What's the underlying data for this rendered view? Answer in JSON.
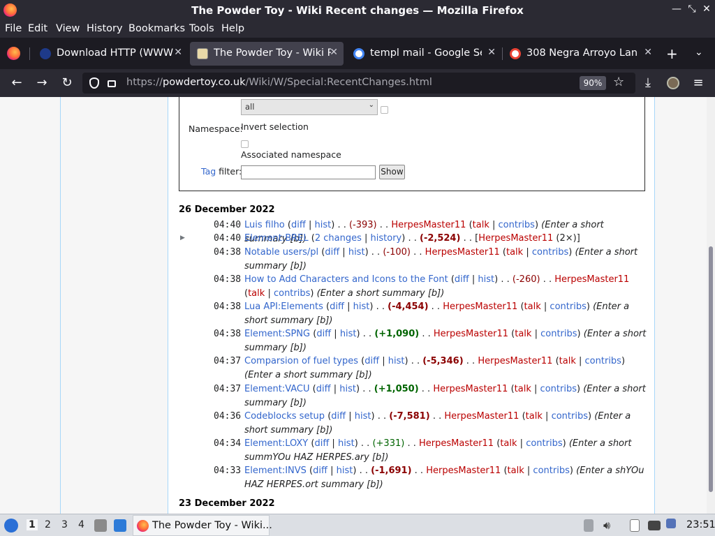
{
  "window": {
    "title": "The Powder Toy - Wiki Recent changes — Mozilla Firefox"
  },
  "menu": [
    "File",
    "Edit",
    "View",
    "History",
    "Bookmarks",
    "Tools",
    "Help"
  ],
  "tabs": [
    {
      "label": "Download HTTP (WWW)",
      "active": false
    },
    {
      "label": "The Powder Toy - Wiki Re",
      "active": true
    },
    {
      "label": "templ mail - Google Sear",
      "active": false
    },
    {
      "label": "308 Negra Arroyo Lane, A",
      "active": false
    }
  ],
  "nav": {
    "url_prefix": "https://",
    "url_domain": "powdertoy.co.uk",
    "url_path": "/Wiki/W/Special:RecentChanges.html",
    "zoom": "90%"
  },
  "form": {
    "select_value": "all",
    "namespace_label": "Namespace:",
    "invert_label": "Invert selection",
    "associated_label": "Associated namespace",
    "tag_link": "Tag",
    "tag_filter_label": "filter:",
    "show_button": "Show"
  },
  "days": [
    {
      "date": "26 December 2022"
    },
    {
      "date": "23 December 2022"
    }
  ],
  "entries": [
    {
      "time": "04:40",
      "title": "Luis filho",
      "diff": "diff",
      "hist": "hist",
      "delta": "(-393)",
      "user": "HerpesMaster11",
      "talk": "talk",
      "contribs": "contribs",
      "summary": "(Enter a short summary [b])"
    },
    {
      "time": "04:40",
      "title": "Element:BREL",
      "changes": "2 changes",
      "history": "history",
      "delta": "(-2,524)",
      "user": "HerpesMaster11",
      "count": "(2×)"
    },
    {
      "time": "04:38",
      "title": "Notable users/pl",
      "diff": "diff",
      "hist": "hist",
      "delta": "(-100)",
      "user": "HerpesMaster11",
      "talk": "talk",
      "contribs": "contribs",
      "summary": "(Enter a short summary [b])"
    },
    {
      "time": "04:38",
      "title": "How to Add Characters and Icons to the Font",
      "diff": "diff",
      "hist": "hist",
      "delta": "(-260)",
      "user": "HerpesMaster11",
      "talk": "talk",
      "contribs": "contribs",
      "summary": "(Enter a short summary [b])"
    },
    {
      "time": "04:38",
      "title": "Lua API:Elements",
      "diff": "diff",
      "hist": "hist",
      "delta": "(-4,454)",
      "user": "HerpesMaster11",
      "talk": "talk",
      "contribs": "contribs",
      "summary": "(Enter a short summary [b])"
    },
    {
      "time": "04:38",
      "title": "Element:SPNG",
      "diff": "diff",
      "hist": "hist",
      "delta": "(+1,090)",
      "user": "HerpesMaster11",
      "talk": "talk",
      "contribs": "contribs",
      "summary": "(Enter a short summary [b])"
    },
    {
      "time": "04:37",
      "title": "Comparsion of fuel types",
      "diff": "diff",
      "hist": "hist",
      "delta": "(-5,346)",
      "user": "HerpesMaster11",
      "talk": "talk",
      "contribs": "contribs",
      "summary": "(Enter a short summary [b])"
    },
    {
      "time": "04:37",
      "title": "Element:VACU",
      "diff": "diff",
      "hist": "hist",
      "delta": "(+1,050)",
      "user": "HerpesMaster11",
      "talk": "talk",
      "contribs": "contribs",
      "summary": "(Enter a short summary [b])"
    },
    {
      "time": "04:36",
      "title": "Codeblocks setup",
      "diff": "diff",
      "hist": "hist",
      "delta": "(-7,581)",
      "user": "HerpesMaster11",
      "talk": "talk",
      "contribs": "contribs",
      "summary": "(Enter a short summary [b])"
    },
    {
      "time": "04:34",
      "title": "Element:LOXY",
      "diff": "diff",
      "hist": "hist",
      "delta": "(+331)",
      "user": "HerpesMaster11",
      "talk": "talk",
      "contribs": "contribs",
      "summary": "(Enter a short summYOu HAZ HERPES.ary [b])"
    },
    {
      "time": "04:33",
      "title": "Element:INVS",
      "diff": "diff",
      "hist": "hist",
      "delta": "(-1,691)",
      "user": "HerpesMaster11",
      "talk": "talk",
      "contribs": "contribs",
      "summary": "(Enter a shYOu HAZ HERPES.ort summary [b])"
    }
  ],
  "sep": {
    "dots": ". .",
    "pipe": "|",
    "open": "(",
    "close": ")",
    "lbr": "[",
    "rbr": "]"
  },
  "taskbar": {
    "workspaces": [
      "1",
      "2",
      "3",
      "4"
    ],
    "task_title": "The Powder Toy - Wiki...",
    "clock": "23:51"
  }
}
